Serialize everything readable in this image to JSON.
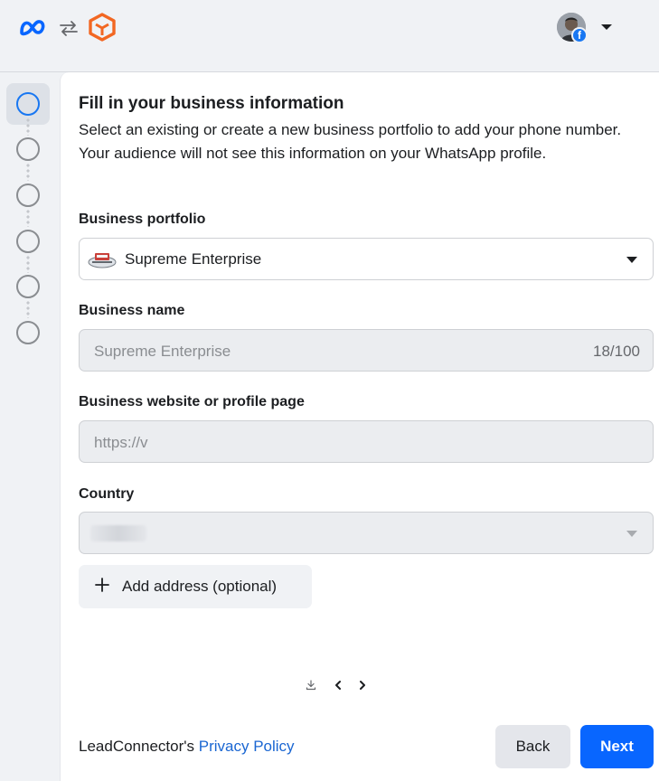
{
  "colors": {
    "meta_blue": "#0866ff",
    "brand_orange": "#f26722",
    "step_active": "#1877f2",
    "link": "#1a66d2",
    "primary_button": "#0866ff"
  },
  "header": {
    "icons": [
      "meta-logo-icon",
      "swap-arrows-icon",
      "brand-cube-icon",
      "profile-avatar",
      "facebook-badge-icon",
      "caret-down-icon"
    ],
    "fb_badge_glyph": "f"
  },
  "stepper": {
    "total_steps": 6,
    "active_step": 1
  },
  "form": {
    "title": "Fill in your business information",
    "subtitle": "Select an existing or create a new business portfolio to add your phone number. Your audience will not see this information on your WhatsApp profile.",
    "portfolio": {
      "label": "Business portfolio",
      "selected": "Supreme Enterprise"
    },
    "name": {
      "label": "Business name",
      "value": "Supreme Enterprise",
      "counter": "18/100"
    },
    "website": {
      "label": "Business website or profile page",
      "value": "https://v"
    },
    "country": {
      "label": "Country"
    },
    "add_address_label": "Add address (optional)"
  },
  "footer": {
    "privacy_prefix": "LeadConnector's ",
    "privacy_link": "Privacy Policy",
    "back_label": "Back",
    "next_label": "Next"
  }
}
